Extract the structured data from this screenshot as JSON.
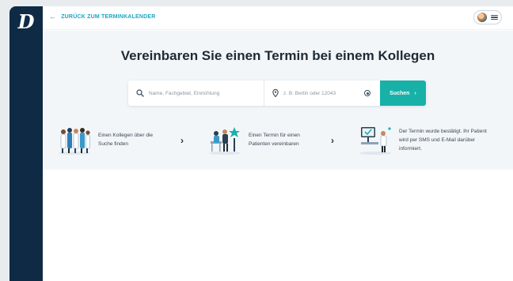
{
  "sidebar": {
    "logo_letter": "D"
  },
  "topbar": {
    "back_label": "ZURÜCK ZUM TERMINKALENDER",
    "back_icon": "arrow-left-icon"
  },
  "hero": {
    "title": "Vereinbaren Sie einen Termin bei einem Kollegen",
    "search": {
      "name_placeholder": "Name, Fachgebiet, Einrichtung",
      "location_placeholder": "z. B. Berlin oder 12043",
      "button_label": "Suchen"
    },
    "steps": [
      {
        "text_line1": "Einen Kollegen über die",
        "text_line2": "Suche finden",
        "text_line3": ""
      },
      {
        "text_line1": "Einen Termin für einen",
        "text_line2": "Patienten vereinbaren",
        "text_line3": ""
      },
      {
        "text_line1": "Der Termin wurde bestätigt. Ihr Patient",
        "text_line2": "wird per SMS und E-Mail darüber",
        "text_line3": "informiert."
      }
    ]
  },
  "colors": {
    "sidebar": "#0f2a44",
    "accent": "#17b1a8",
    "link": "#1aa6c4",
    "hero_bg": "#f2f6f9"
  }
}
